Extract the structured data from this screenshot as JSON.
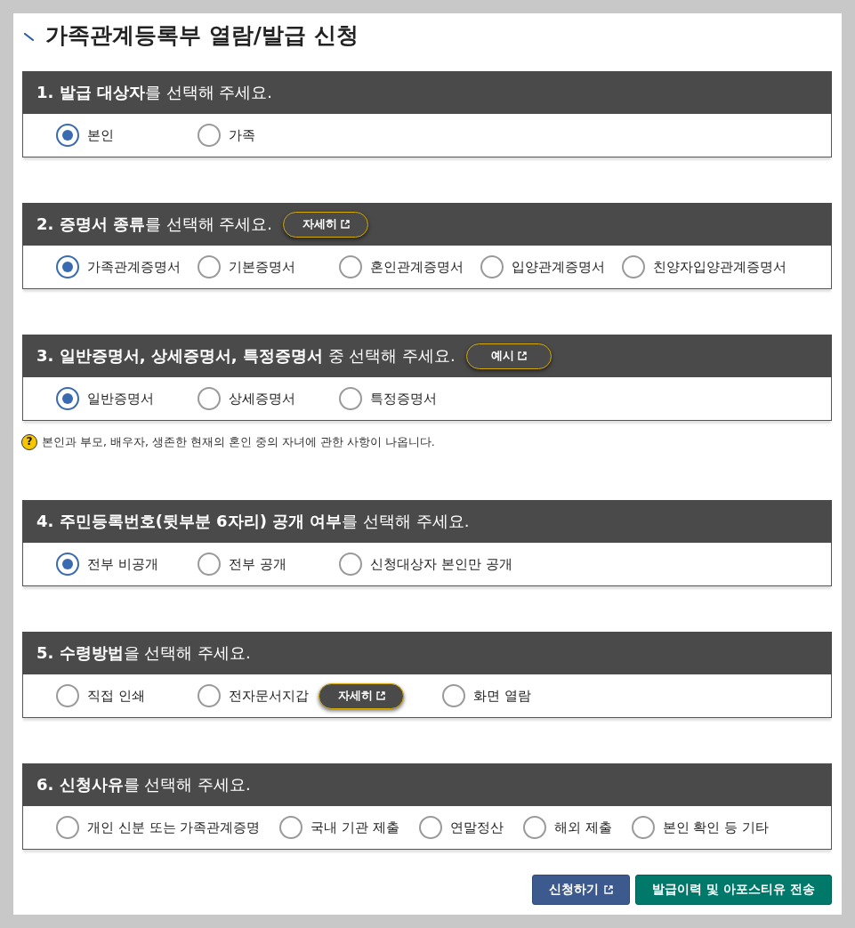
{
  "title": "가족관계등록부 열람/발급 신청",
  "sections": [
    {
      "heading": "**1. 발급 대상자**를 선택해 주세요.",
      "options": [
        {
          "label": "본인",
          "selected": true
        },
        {
          "label": "가족",
          "selected": false
        }
      ]
    },
    {
      "heading": "**2. 증명서 종류**를 선택해 주세요.",
      "button": {
        "label": "자세히",
        "external": true
      },
      "options": [
        {
          "label": "가족관계증명서",
          "selected": true
        },
        {
          "label": "기본증명서",
          "selected": false
        },
        {
          "label": "혼인관계증명서",
          "selected": false
        },
        {
          "label": "입양관계증명서",
          "selected": false
        },
        {
          "label": "친양자입양관계증명서",
          "selected": false
        }
      ]
    },
    {
      "heading": "**3. 일반증명서, 상세증명서, 특정증명서** 중 선택해 주세요.",
      "button": {
        "label": "예시",
        "external": true
      },
      "options": [
        {
          "label": "일반증명서",
          "selected": true
        },
        {
          "label": "상세증명서",
          "selected": false
        },
        {
          "label": "특정증명서",
          "selected": false
        }
      ],
      "note": {
        "icon": "?",
        "text": "본인과 부모, 배우자, 생존한 현재의 혼인 중의 자녀에 관한 사항이 나옵니다."
      }
    },
    {
      "heading": "**4. 주민등록번호(뒷부분 6자리) 공개 여부**를 선택해 주세요.",
      "options": [
        {
          "label": "전부 비공개",
          "selected": true
        },
        {
          "label": "전부 공개",
          "selected": false
        },
        {
          "label": "신청대상자 본인만 공개",
          "selected": false
        }
      ]
    },
    {
      "heading": "**5. 수령방법**을 선택해 주세요.",
      "options": [
        {
          "label": "직접 인쇄",
          "selected": false
        },
        {
          "label": "전자문서지갑",
          "selected": false,
          "button": {
            "label": "자세히",
            "external": true
          }
        },
        {
          "label": "화면 열람",
          "selected": false
        }
      ]
    },
    {
      "heading": "**6. 신청사유**를 선택해 주세요.",
      "options": [
        {
          "label": "개인 신분 또는 가족관계증명",
          "selected": false
        },
        {
          "label": "국내 기관 제출",
          "selected": false
        },
        {
          "label": "연말정산",
          "selected": false
        },
        {
          "label": "해외 제출",
          "selected": false
        },
        {
          "label": "본인 확인 등 기타",
          "selected": false
        }
      ]
    }
  ],
  "actions": [
    {
      "label": "신청하기",
      "kind": "primary",
      "external": true
    },
    {
      "label": "발급이력 및 아포스티유 전송",
      "kind": "secondary",
      "external": false
    }
  ]
}
